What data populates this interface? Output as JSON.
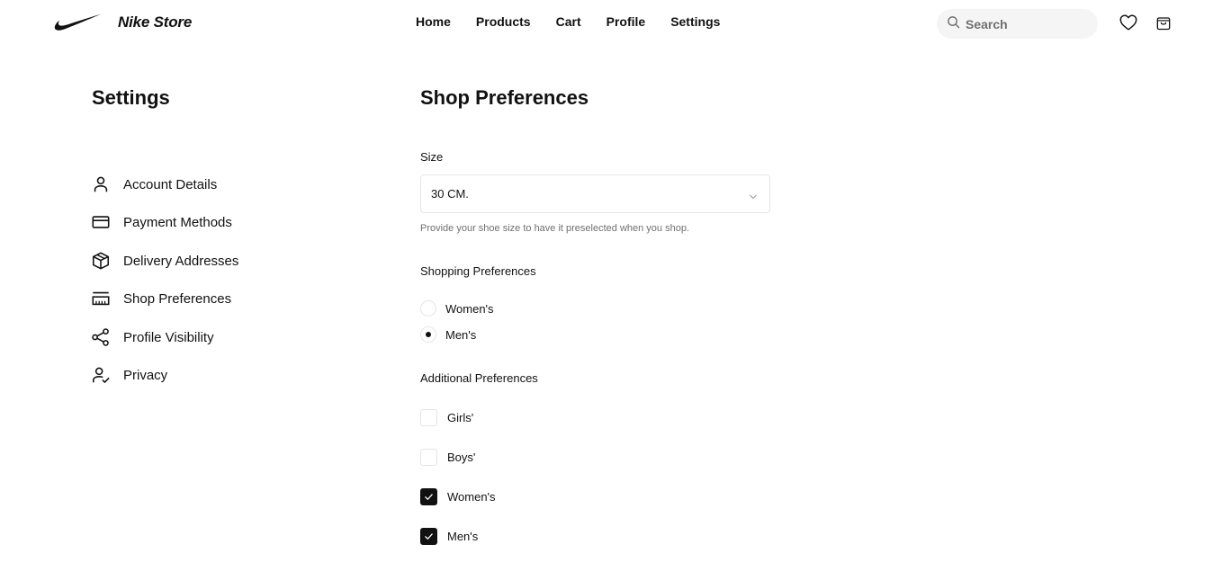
{
  "header": {
    "store_name": "Nike Store",
    "nav": [
      "Home",
      "Products",
      "Cart",
      "Profile",
      "Settings"
    ],
    "search_placeholder": "Search",
    "icons": [
      "swoosh-logo",
      "search-icon",
      "heart-icon",
      "bag-icon"
    ]
  },
  "sidebar": {
    "title": "Settings",
    "items": [
      {
        "label": "Account Details",
        "icon": "user-icon"
      },
      {
        "label": "Payment Methods",
        "icon": "card-icon"
      },
      {
        "label": "Delivery Addresses",
        "icon": "package-icon"
      },
      {
        "label": "Shop Preferences",
        "icon": "ruler-icon"
      },
      {
        "label": "Profile Visibility",
        "icon": "share-icon"
      },
      {
        "label": "Privacy",
        "icon": "user-check-icon"
      }
    ]
  },
  "main": {
    "title": "Shop Preferences",
    "size": {
      "label": "Size",
      "value": "30 CM.",
      "helper": "Provide your shoe size to have it preselected when you shop."
    },
    "shopping": {
      "label": "Shopping Preferences",
      "options": [
        {
          "label": "Women's",
          "selected": false
        },
        {
          "label": "Men's",
          "selected": true
        }
      ]
    },
    "additional": {
      "label": "Additional Preferences",
      "options": [
        {
          "label": "Girls'",
          "checked": false
        },
        {
          "label": "Boys'",
          "checked": false
        },
        {
          "label": "Women's",
          "checked": true
        },
        {
          "label": "Men's",
          "checked": true
        }
      ]
    }
  },
  "colors": {
    "text": "#111111",
    "muted": "#707072",
    "border": "#e5e5e5",
    "search_bg": "#f5f5f5"
  }
}
